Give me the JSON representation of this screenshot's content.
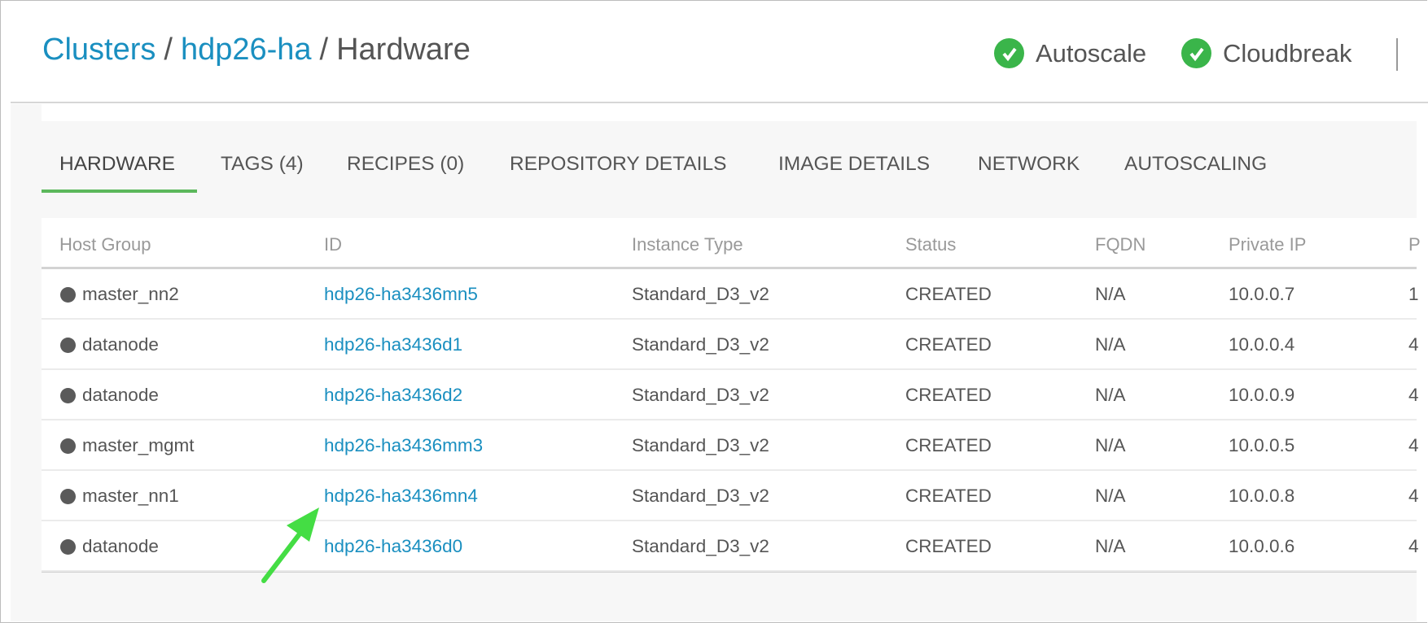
{
  "breadcrumb": {
    "items": [
      "Clusters",
      "hdp26-ha",
      "Hardware"
    ],
    "separator": "/"
  },
  "status": [
    {
      "label": "Autoscale",
      "icon": "check-circle-icon",
      "color": "#3ab54a"
    },
    {
      "label": "Cloudbreak",
      "icon": "check-circle-icon",
      "color": "#3ab54a"
    }
  ],
  "tabs": [
    {
      "label": "HARDWARE",
      "active": true
    },
    {
      "label": "TAGS (4)"
    },
    {
      "label": "RECIPES (0)"
    },
    {
      "label": "REPOSITORY DETAILS"
    },
    {
      "label": "IMAGE DETAILS"
    },
    {
      "label": "NETWORK"
    },
    {
      "label": "AUTOSCALING"
    }
  ],
  "table": {
    "columns": [
      "Host Group",
      "ID",
      "Instance Type",
      "Status",
      "FQDN",
      "Private IP",
      "P"
    ],
    "rows": [
      [
        "master_nn2",
        "hdp26-ha3436mn5",
        "Standard_D3_v2",
        "CREATED",
        "N/A",
        "10.0.0.7",
        "1"
      ],
      [
        "datanode",
        "hdp26-ha3436d1",
        "Standard_D3_v2",
        "CREATED",
        "N/A",
        "10.0.0.4",
        "4"
      ],
      [
        "datanode",
        "hdp26-ha3436d2",
        "Standard_D3_v2",
        "CREATED",
        "N/A",
        "10.0.0.9",
        "4"
      ],
      [
        "master_mgmt",
        "hdp26-ha3436mm3",
        "Standard_D3_v2",
        "CREATED",
        "N/A",
        "10.0.0.5",
        "4"
      ],
      [
        "master_nn1",
        "hdp26-ha3436mn4",
        "Standard_D3_v2",
        "CREATED",
        "N/A",
        "10.0.0.8",
        "4"
      ],
      [
        "datanode",
        "hdp26-ha3436d0",
        "Standard_D3_v2",
        "CREATED",
        "N/A",
        "10.0.0.6",
        "4"
      ]
    ]
  },
  "annotation": {
    "icon": "green-arrow-icon",
    "color": "#44dd44"
  },
  "colors": {
    "accent": "#5cb85c",
    "link": "#1a8fc0"
  }
}
